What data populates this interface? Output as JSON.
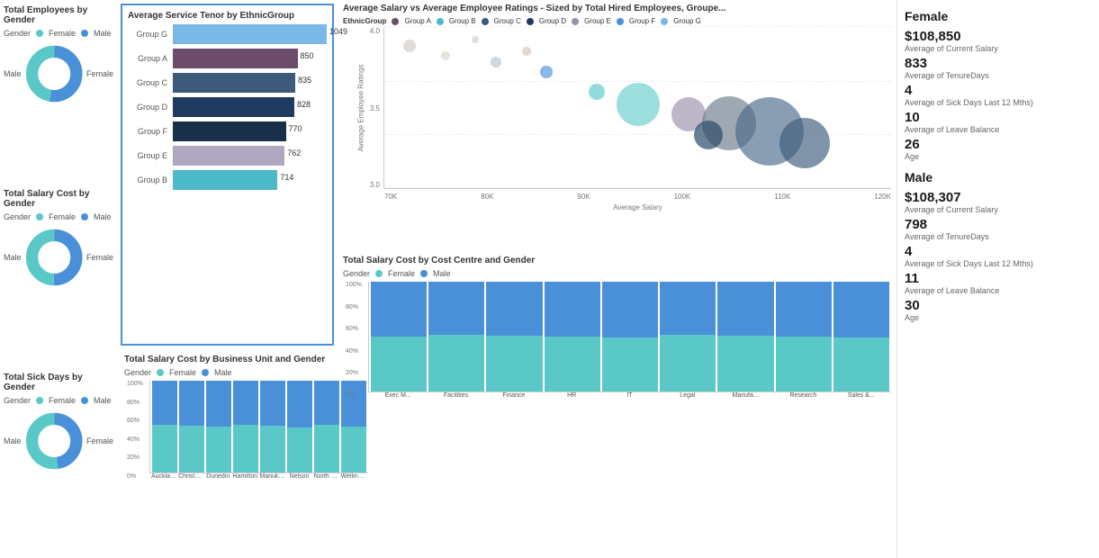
{
  "leftCharts": [
    {
      "title": "Total Employees by Gender",
      "legendLabel": "Gender",
      "items": [
        {
          "label": "Female",
          "color": "#5bc8c8"
        },
        {
          "label": "Male",
          "color": "#4a90d9"
        }
      ],
      "maleLabel": "Male",
      "femaleLabel": "Female",
      "malePct": 52,
      "femalePct": 48
    },
    {
      "title": "Total Salary Cost by Gender",
      "legendLabel": "Gender",
      "items": [
        {
          "label": "Female",
          "color": "#5bc8c8"
        },
        {
          "label": "Male",
          "color": "#4a90d9"
        }
      ],
      "maleLabel": "Male",
      "femaleLabel": "Female",
      "malePct": 50,
      "femalePct": 50
    },
    {
      "title": "Total Sick Days by Gender",
      "legendLabel": "Gender",
      "items": [
        {
          "label": "Female",
          "color": "#5bc8c8"
        },
        {
          "label": "Male",
          "color": "#4a90d9"
        }
      ],
      "maleLabel": "Male",
      "femaleLabel": "Female",
      "malePct": 48,
      "femalePct": 52
    }
  ],
  "barChart": {
    "title": "Average Service Tenor by EthnicGroup",
    "bars": [
      {
        "label": "Group G",
        "value": 1049,
        "color": "#7ab8e8"
      },
      {
        "label": "Group A",
        "value": 850,
        "color": "#6b4c6b"
      },
      {
        "label": "Group C",
        "value": 835,
        "color": "#3d5a7a"
      },
      {
        "label": "Group D",
        "value": 828,
        "color": "#1e3a5f"
      },
      {
        "label": "Group F",
        "value": 770,
        "color": "#1a2f4a"
      },
      {
        "label": "Group E",
        "value": 762,
        "color": "#b0a8c0"
      },
      {
        "label": "Group B",
        "value": 714,
        "color": "#4db8c8"
      }
    ],
    "maxValue": 1049
  },
  "scatter": {
    "title": "Average Salary vs Average Employee Ratings - Sized by Total Hired Employees, Groupe...",
    "xLabel": "Average Salary",
    "yLabel": "Average Employee Ratings",
    "legendTitle": "EthnicGroup",
    "groups": [
      {
        "label": "Group A",
        "color": "#6b4c6b"
      },
      {
        "label": "Group B",
        "color": "#4db8c8"
      },
      {
        "label": "Group C",
        "color": "#3d5a7a"
      },
      {
        "label": "Group D",
        "color": "#1e3a5f"
      },
      {
        "label": "Group E",
        "color": "#9b8faa"
      },
      {
        "label": "Group F",
        "color": "#4a90d9"
      },
      {
        "label": "Group G",
        "color": "#7ab8e8"
      }
    ],
    "xTicks": [
      "70K",
      "80K",
      "90K",
      "100K",
      "110K",
      "120K"
    ],
    "yTicks": [
      "3.0",
      "3.5",
      "4.0"
    ],
    "bubbles": [
      {
        "x": 8,
        "y": 88,
        "r": 8,
        "color": "#b0b8c8",
        "opacity": 0.6
      },
      {
        "x": 15,
        "y": 82,
        "r": 6,
        "color": "#c8c0b0",
        "opacity": 0.5
      },
      {
        "x": 28,
        "y": 75,
        "r": 7,
        "color": "#9bb8c8",
        "opacity": 0.6
      },
      {
        "x": 38,
        "y": 68,
        "r": 9,
        "color": "#4a90d9",
        "opacity": 0.7
      },
      {
        "x": 48,
        "y": 62,
        "r": 11,
        "color": "#5bc8c8",
        "opacity": 0.7
      },
      {
        "x": 55,
        "y": 55,
        "r": 28,
        "color": "#5bc8c8",
        "opacity": 0.65
      },
      {
        "x": 65,
        "y": 50,
        "r": 22,
        "color": "#9b8faa",
        "opacity": 0.65
      },
      {
        "x": 72,
        "y": 45,
        "r": 35,
        "color": "#7a8a9a",
        "opacity": 0.65
      },
      {
        "x": 80,
        "y": 40,
        "r": 40,
        "color": "#5a7a9a",
        "opacity": 0.65
      },
      {
        "x": 70,
        "y": 38,
        "r": 18,
        "color": "#3d5a7a",
        "opacity": 0.7
      },
      {
        "x": 85,
        "y": 35,
        "r": 30,
        "color": "#4a6a8a",
        "opacity": 0.65
      },
      {
        "x": 30,
        "y": 85,
        "r": 5,
        "color": "#c8b0a0",
        "opacity": 0.5
      },
      {
        "x": 18,
        "y": 92,
        "r": 4,
        "color": "#b8c8d0",
        "opacity": 0.5
      }
    ]
  },
  "stackedBusiness": {
    "title": "Total Salary Cost by Business Unit and Gender",
    "legendLabel": "Gender",
    "items": [
      {
        "label": "Female",
        "color": "#5bc8c8"
      },
      {
        "label": "Male",
        "color": "#4a90d9"
      }
    ],
    "yTicks": [
      "100%",
      "80%",
      "60%",
      "40%",
      "20%",
      "0%"
    ],
    "bars": [
      {
        "label": "Auckland",
        "female": 52,
        "male": 48
      },
      {
        "label": "Christch...",
        "female": 51,
        "male": 49
      },
      {
        "label": "Dunedin",
        "female": 50,
        "male": 50
      },
      {
        "label": "Hamilton",
        "female": 52,
        "male": 48
      },
      {
        "label": "Manukau",
        "female": 51,
        "male": 49
      },
      {
        "label": "Nelson",
        "female": 49,
        "male": 51
      },
      {
        "label": "North S...",
        "female": 52,
        "male": 48
      },
      {
        "label": "Wellingt...",
        "female": 50,
        "male": 50
      }
    ]
  },
  "stackedCost": {
    "title": "Total Salary Cost by Cost Centre and Gender",
    "legendLabel": "Gender",
    "items": [
      {
        "label": "Female",
        "color": "#5bc8c8"
      },
      {
        "label": "Male",
        "color": "#4a90d9"
      }
    ],
    "yTicks": [
      "100%",
      "50%",
      "0%"
    ],
    "bars": [
      {
        "label": "Exec M...",
        "female": 50,
        "male": 50
      },
      {
        "label": "Facilities",
        "female": 52,
        "male": 48
      },
      {
        "label": "Finance",
        "female": 51,
        "male": 49
      },
      {
        "label": "HR",
        "female": 50,
        "male": 50
      },
      {
        "label": "IT",
        "female": 49,
        "male": 51
      },
      {
        "label": "Legal",
        "female": 52,
        "male": 48
      },
      {
        "label": "Manufa...",
        "female": 51,
        "male": 49
      },
      {
        "label": "Research",
        "female": 50,
        "male": 50
      },
      {
        "label": "Sales &...",
        "female": 49,
        "male": 51
      }
    ]
  },
  "stats": {
    "female": {
      "gender": "Female",
      "salary": "$108,850",
      "salaryLabel": "Average of Current Salary",
      "tenure": "833",
      "tenureLabel": "Average of TenureDays",
      "sick": "4",
      "sickLabel": "Average of Sick Days Last 12 Mths)",
      "leave": "10",
      "leaveLabel": "Average of Leave Balance",
      "age": "26",
      "ageLabel": "Age"
    },
    "male": {
      "gender": "Male",
      "salary": "$108,307",
      "salaryLabel": "Average of Current Salary",
      "tenure": "798",
      "tenureLabel": "Average of TenureDays",
      "sick": "4",
      "sickLabel": "Average of Sick Days Last 12 Mths)",
      "leave": "11",
      "leaveLabel": "Average of Leave Balance",
      "age": "30",
      "ageLabel": "Age"
    }
  }
}
